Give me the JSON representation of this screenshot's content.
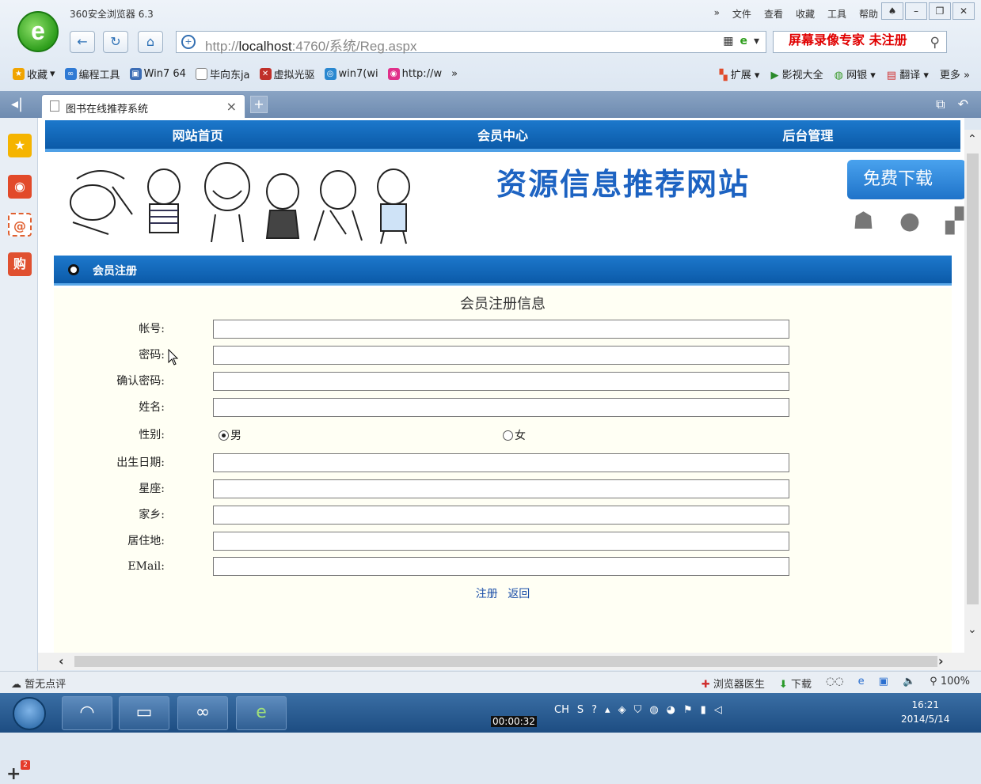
{
  "browser": {
    "app_title": "360安全浏览器 6.3",
    "menu": [
      "文件",
      "查看",
      "收藏",
      "工具",
      "帮助"
    ],
    "menu_more": "»",
    "url_prefix": "http://",
    "url_host": "localhost",
    "url_rest": ":4760/系统/Reg.aspx",
    "recorder_label": "屏幕录像专家 未注册",
    "bookmarks": [
      {
        "label": "收藏",
        "color": "#f0a400"
      },
      {
        "label": "编程工具",
        "color": "#2f7ad4"
      },
      {
        "label": "Win7 64",
        "color": "#3c6db5"
      },
      {
        "label": "毕向东ja",
        "color": "#888888"
      },
      {
        "label": "虚拟光驱",
        "color": "#c0302a"
      },
      {
        "label": "win7(wi",
        "color": "#2a88d0"
      },
      {
        "label": "http://w",
        "color": "#e0308a"
      }
    ],
    "bookmarks_more": "»",
    "bookmarks_right": [
      "扩展",
      "影视大全",
      "网银",
      "翻译",
      "更多 »"
    ],
    "tab_label": "图书在线推荐系统",
    "status_left": "暂无点评",
    "status_right": [
      "浏览器医生",
      "下载",
      "100%"
    ]
  },
  "site": {
    "nav": [
      "网站首页",
      "会员中心",
      "后台管理"
    ],
    "banner_title": "资源信息推荐网站",
    "download_label": "免费下载",
    "section_title": "会员注册",
    "form_heading": "会员注册信息",
    "fields": [
      {
        "label": "帐号:",
        "value": ""
      },
      {
        "label": "密码:",
        "value": ""
      },
      {
        "label": "确认密码:",
        "value": ""
      },
      {
        "label": "姓名:",
        "value": ""
      },
      {
        "label": "出生日期:",
        "value": ""
      },
      {
        "label": "星座:",
        "value": ""
      },
      {
        "label": "家乡:",
        "value": ""
      },
      {
        "label": "居住地:",
        "value": ""
      },
      {
        "label": "EMail:",
        "value": ""
      }
    ],
    "gender_label": "性别:",
    "gender_options": [
      "男",
      "女"
    ],
    "gender_selected": "男",
    "register_label": "注册",
    "back_label": "返回"
  },
  "taskbar": {
    "record_time": "00:00:32",
    "tray_lang": "CH",
    "time": "16:21",
    "date": "2014/5/14"
  },
  "sidebar": {
    "badge": "2"
  },
  "colors": {
    "nav_blue": "#0b5aa8",
    "banner_title": "#1d63c2",
    "recorder_red": "#e00000",
    "form_bg": "#fffff4",
    "link_blue": "#1b4fa8"
  }
}
